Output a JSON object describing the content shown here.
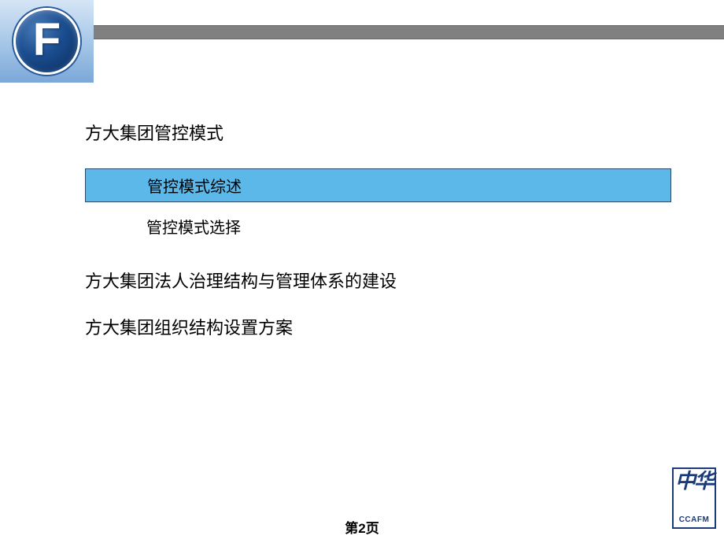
{
  "logo": {
    "letter": "F"
  },
  "outline": {
    "section1": {
      "title": "方大集团管控模式",
      "sub1": "管控模式综述",
      "sub2": "管控模式选择"
    },
    "section2": {
      "title": "方大集团法人治理结构与管理体系的建设"
    },
    "section3": {
      "title": "方大集团组织结构设置方案"
    }
  },
  "footer_logo": {
    "chinese": "中华",
    "english": "CCAFM"
  },
  "page_number": "第2页"
}
